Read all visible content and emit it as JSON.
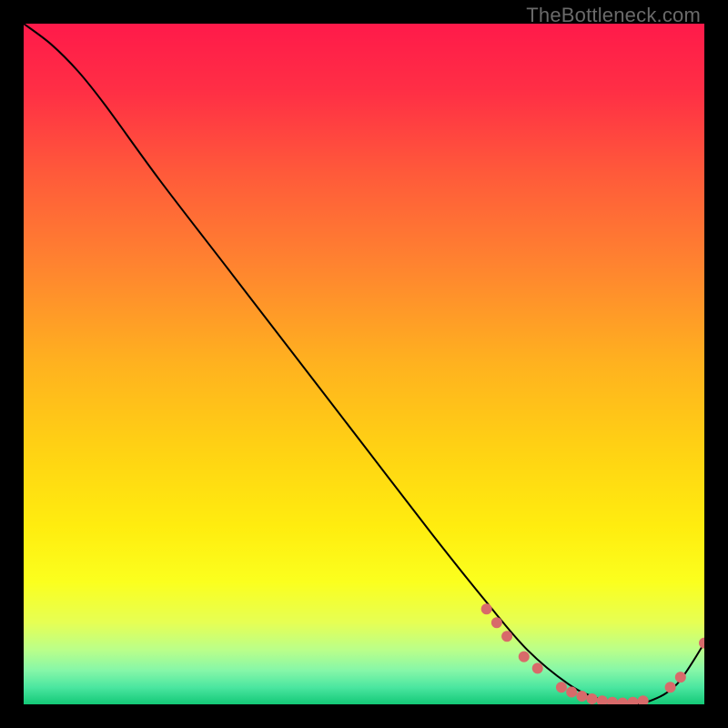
{
  "watermark": "TheBottleneck.com",
  "chart_data": {
    "type": "line",
    "title": "",
    "xlabel": "",
    "ylabel": "",
    "xlim": [
      0,
      100
    ],
    "ylim": [
      0,
      100
    ],
    "grid": false,
    "legend": false,
    "series": [
      {
        "name": "bottleneck-curve",
        "color": "#000000",
        "x": [
          0,
          4,
          8,
          12,
          20,
          30,
          40,
          50,
          60,
          68,
          74,
          80,
          84,
          88,
          92,
          96,
          100
        ],
        "y": [
          100,
          97,
          93,
          88,
          77,
          64,
          51,
          38,
          25,
          15,
          8,
          3,
          1,
          0,
          0.5,
          3,
          9
        ]
      }
    ],
    "markers": [
      {
        "x": 68.0,
        "y": 14.0
      },
      {
        "x": 69.5,
        "y": 12.0
      },
      {
        "x": 71.0,
        "y": 10.0
      },
      {
        "x": 73.5,
        "y": 7.0
      },
      {
        "x": 75.5,
        "y": 5.3
      },
      {
        "x": 79.0,
        "y": 2.5
      },
      {
        "x": 80.5,
        "y": 1.8
      },
      {
        "x": 82.0,
        "y": 1.2
      },
      {
        "x": 83.5,
        "y": 0.8
      },
      {
        "x": 85.0,
        "y": 0.5
      },
      {
        "x": 86.5,
        "y": 0.3
      },
      {
        "x": 88.0,
        "y": 0.2
      },
      {
        "x": 89.5,
        "y": 0.3
      },
      {
        "x": 91.0,
        "y": 0.5
      },
      {
        "x": 95.0,
        "y": 2.5
      },
      {
        "x": 96.5,
        "y": 4.0
      },
      {
        "x": 100.0,
        "y": 9.0
      }
    ],
    "gradient_stops": [
      {
        "offset": 0.0,
        "color": "#ff1a4a"
      },
      {
        "offset": 0.1,
        "color": "#ff2f45"
      },
      {
        "offset": 0.22,
        "color": "#ff5a3a"
      },
      {
        "offset": 0.35,
        "color": "#ff8230"
      },
      {
        "offset": 0.5,
        "color": "#ffb21f"
      },
      {
        "offset": 0.63,
        "color": "#ffd313"
      },
      {
        "offset": 0.74,
        "color": "#ffed0f"
      },
      {
        "offset": 0.82,
        "color": "#fbff1e"
      },
      {
        "offset": 0.88,
        "color": "#e6ff54"
      },
      {
        "offset": 0.92,
        "color": "#baff8a"
      },
      {
        "offset": 0.95,
        "color": "#86f7a8"
      },
      {
        "offset": 0.975,
        "color": "#4be6a0"
      },
      {
        "offset": 1.0,
        "color": "#13c977"
      }
    ],
    "marker_style": {
      "fill": "#d86a6a",
      "radius": 6
    }
  }
}
